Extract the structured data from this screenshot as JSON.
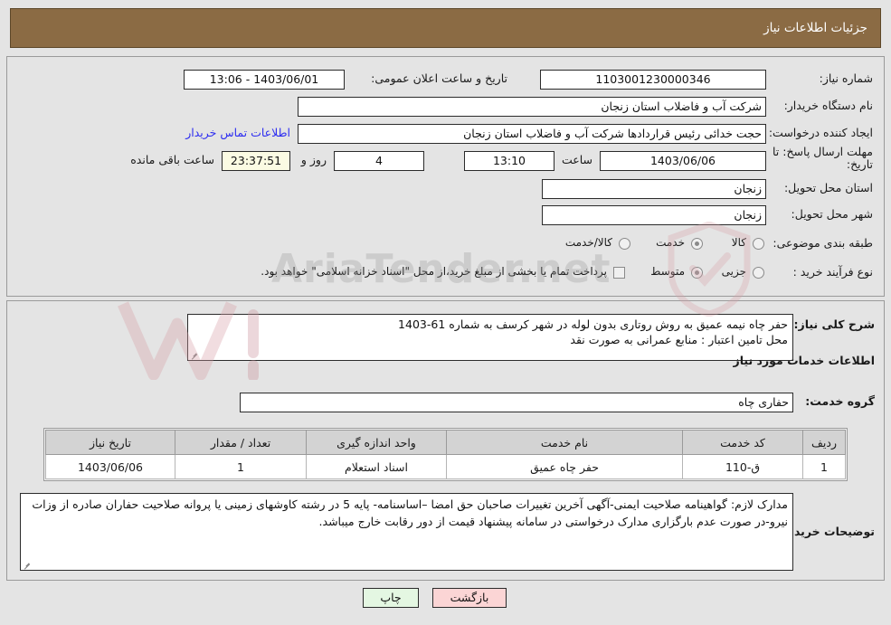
{
  "header": {
    "title": "جزئیات اطلاعات نیاز"
  },
  "watermark": {
    "text": "AriaTender.net"
  },
  "top_panel": {
    "need_number": {
      "label": "شماره نیاز:",
      "value": "1103001230000346"
    },
    "announce": {
      "label": "تاریخ و ساعت اعلان عمومی:",
      "value": "1403/06/01 - 13:06"
    },
    "buyer_org": {
      "label": "نام دستگاه خریدار:",
      "value": "شرکت آب و فاضلاب استان زنجان"
    },
    "requester": {
      "label": "ایجاد کننده درخواست:",
      "value": "حجت  خدائی رئیس قراردادها شرکت آب و فاضلاب استان زنجان"
    },
    "contact_link": "اطلاعات تماس خریدار",
    "deadline": {
      "label": "مهلت ارسال پاسخ: تا تاریخ:",
      "date": "1403/06/06",
      "hour_label": "ساعت",
      "time": "13:10",
      "days": "4",
      "days_label": "روز و",
      "timer": "23:37:51",
      "timer_label": "ساعت باقی مانده"
    },
    "province": {
      "label": "استان محل تحویل:",
      "value": "زنجان"
    },
    "city": {
      "label": "شهر محل تحویل:",
      "value": "زنجان"
    },
    "category": {
      "label": "طبقه بندی موضوعی:",
      "options": [
        "کالا",
        "خدمت",
        "کالا/خدمت"
      ],
      "selected": "خدمت"
    },
    "purchase_type": {
      "label": "نوع فرآیند خرید :",
      "options": [
        "جزیی",
        "متوسط"
      ],
      "selected": "متوسط",
      "checkbox_label": "پرداخت تمام یا بخشی از مبلغ خرید،از محل \"اسناد خزانه اسلامی\" خواهد بود.",
      "checkbox_checked": false
    }
  },
  "bottom_panel": {
    "need_desc": {
      "label": "شرح کلی نیاز:",
      "value": "حفر چاه نیمه عمیق به روش روتاری بدون لوله در شهر کرسف به شماره 61-1403\nمحل تامین اعتبار : منابع عمرانی به صورت نقد"
    },
    "section_title": "اطلاعات خدمات مورد نیاز",
    "service_group": {
      "label": "گروه خدمت:",
      "value": "حفاری چاه"
    },
    "table": {
      "columns": [
        "ردیف",
        "کد خدمت",
        "نام خدمت",
        "واحد اندازه گیری",
        "تعداد / مقدار",
        "تاریخ نیاز"
      ],
      "rows": [
        [
          "1",
          "ق-110",
          "حفر چاه عمیق",
          "اسناد استعلام",
          "1",
          "1403/06/06"
        ]
      ]
    },
    "buyer_notes": {
      "label": "توضیحات خریدار:",
      "value": "مدارک لازم: گواهینامه صلاحیت ایمنی-آگهی آخرین تغییرات صاحبان حق امضا –اساسنامه- پایه 5 در رشته کاوشهای زمینی یا پروانه صلاحیت حفاران صادره از وزات نیرو-در صورت عدم بارگزاری مدارک درخواستی در سامانه پیشنهاد قیمت از دور رقابت خارج میباشد."
    }
  },
  "footer": {
    "back_button": "بازگشت",
    "print_button": "چاپ"
  }
}
